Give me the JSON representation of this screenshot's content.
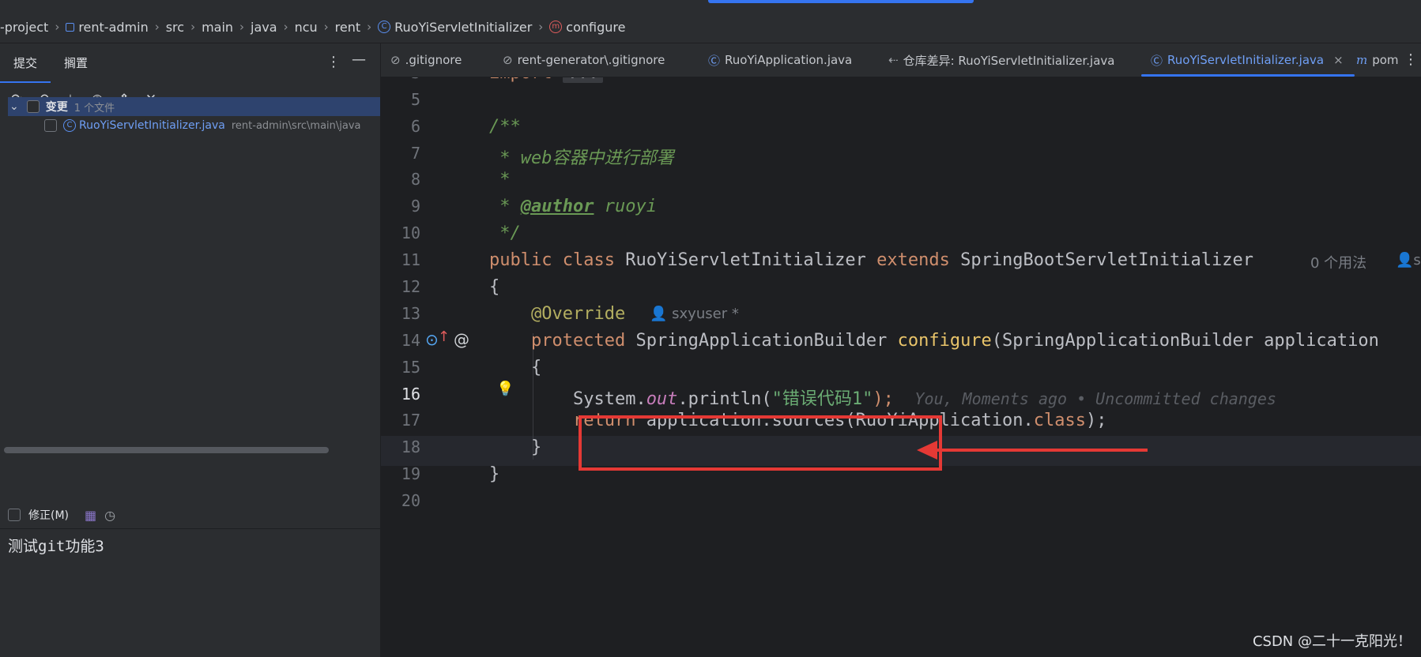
{
  "breadcrumb": {
    "items": [
      "-project",
      "rent-admin",
      "src",
      "main",
      "java",
      "ncu",
      "rent",
      "RuoYiServletInitializer",
      "configure"
    ]
  },
  "commit_panel": {
    "tabs": [
      "提交",
      "搁置"
    ],
    "toolbar_icons": [
      "refresh-icon",
      "rollback-icon",
      "update-icon",
      "eye-icon",
      "expand-icon",
      "collapse-icon"
    ],
    "changes": {
      "group_label": "变更",
      "group_count": "1 个文件",
      "file_name": "RuoYiServletInitializer.java",
      "file_path": "rent-admin\\src\\main\\java"
    },
    "amend_label": "修正(M)",
    "commit_message": "测试git功能3"
  },
  "editor_tabs": [
    {
      "label": ".gitignore",
      "icon": "ignore-icon"
    },
    {
      "label": "rent-generator\\.gitignore",
      "icon": "ignore-icon"
    },
    {
      "label": "RuoYiApplication.java",
      "icon": "class-icon"
    },
    {
      "label": "仓库差异: RuoYiServletInitializer.java",
      "icon": "diff-icon"
    },
    {
      "label": "RuoYiServletInitializer.java",
      "icon": "class-icon",
      "active": true
    },
    {
      "label": "pom",
      "icon": "maven-icon"
    }
  ],
  "editor": {
    "line_numbers": [
      "3",
      "5",
      "6",
      "7",
      "8",
      "9",
      "10",
      "11",
      "12",
      "13",
      "14",
      "15",
      "16",
      "17",
      "18",
      "19",
      "20"
    ],
    "import_kw": "import",
    "import_folded": "...",
    "doc_open": "/**",
    "doc_line1": " * web容器中进行部署",
    "doc_line2": " *",
    "doc_line3_prefix": " * ",
    "doc_author_tag": "@author",
    "doc_author_name": " ruoyi",
    "doc_close": " */",
    "class_decl": {
      "kw1": "public",
      "kw2": "class",
      "name": "RuoYiServletInitializer",
      "kw3": "extends",
      "parent": "SpringBootServletInitializer"
    },
    "class_usages_hint": "0 个用法",
    "class_author_hint": "s",
    "open_brace": "{",
    "override": "@Override",
    "override_author_hint": "sxyuser *",
    "method_decl": {
      "kw": "protected",
      "ret": "SpringApplicationBuilder",
      "name": "configure",
      "param": "(SpringApplicationBuilder application"
    },
    "method_open": "{",
    "line16": {
      "obj": "System.",
      "field": "out",
      "call": ".println(",
      "str": "\"错误代码1\"",
      "end": ");"
    },
    "line16_blame": "You, Moments ago • Uncommitted changes",
    "line17": {
      "kw": "return",
      "rest": " application.sources(RuoYiApplication.",
      "kw2": "class",
      "end": ");"
    },
    "method_close": "}",
    "class_close": "}"
  },
  "watermark": "CSDN @二十一克阳光！",
  "colors": {
    "accent": "#3574f0",
    "highlight_box": "#e53935"
  }
}
